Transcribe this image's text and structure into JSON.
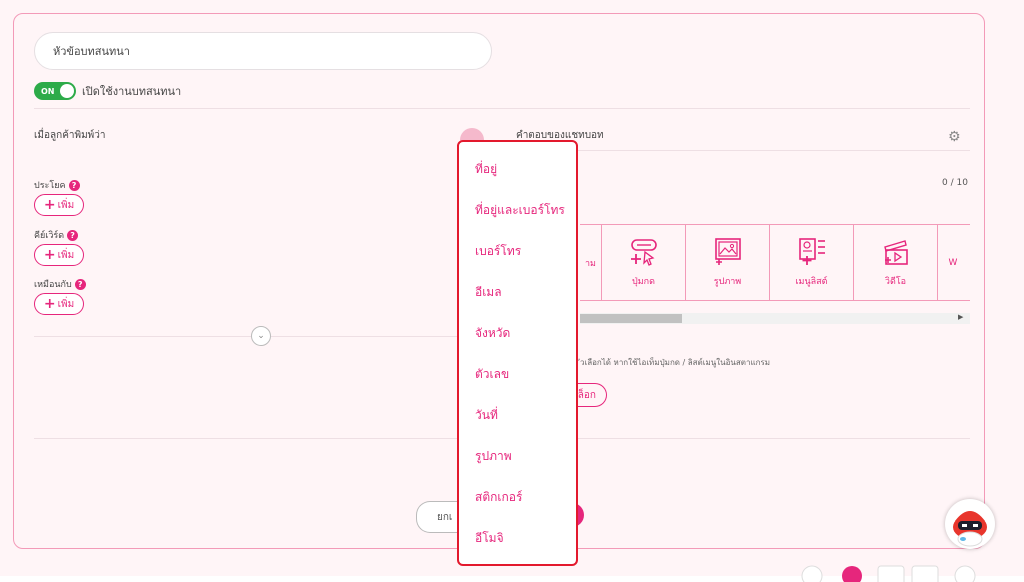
{
  "topic": {
    "placeholder": "หัวข้อบทสนทนา"
  },
  "enable_toggle": {
    "state_label": "ON",
    "label": "เปิดใช้งานบทสนทนา"
  },
  "left_panel": {
    "header": "เมื่อลูกค้าพิมพ์ว่า",
    "sections": [
      {
        "label": "ประโยค",
        "add_label": "เพิ่ม"
      },
      {
        "label": "คีย์เวิร์ด",
        "add_label": "เพิ่ม"
      },
      {
        "label": "เหมือนกับ",
        "add_label": "เพิ่ม"
      }
    ]
  },
  "right_panel": {
    "header": "คำตอบของแชทบอท",
    "counter": "0 / 10",
    "tools": [
      {
        "label": "าม",
        "icon": "message-icon"
      },
      {
        "label": "ปุ่มกด",
        "icon": "button-click-icon"
      },
      {
        "label": "รูปภาพ",
        "icon": "image-add-icon"
      },
      {
        "label": "เมนูลิสต์",
        "icon": "menu-list-icon"
      },
      {
        "label": "วิดีโอ",
        "icon": "video-icon"
      },
      {
        "label": "W",
        "icon": "more-icon"
      }
    ],
    "hint": "ัวเลือกได้ หากใช้ไอเท็มปุ่มกด / ลิสต์เมนูในอินสตาแกรม",
    "choice_button": "ล็อก"
  },
  "footer": {
    "cancel_label": "ยกเ"
  },
  "dropdown": {
    "items": [
      "ที่อยู่",
      "ที่อยู่และเบอร์โทร",
      "เบอร์โทร",
      "อีเมล",
      "จังหวัด",
      "ตัวเลข",
      "วันที่",
      "รูปภาพ",
      "สติกเกอร์",
      "อีโมจิ"
    ]
  },
  "colors": {
    "accent": "#e6267c",
    "toggle_on": "#2dab49",
    "dropdown_border": "#e3192d"
  }
}
